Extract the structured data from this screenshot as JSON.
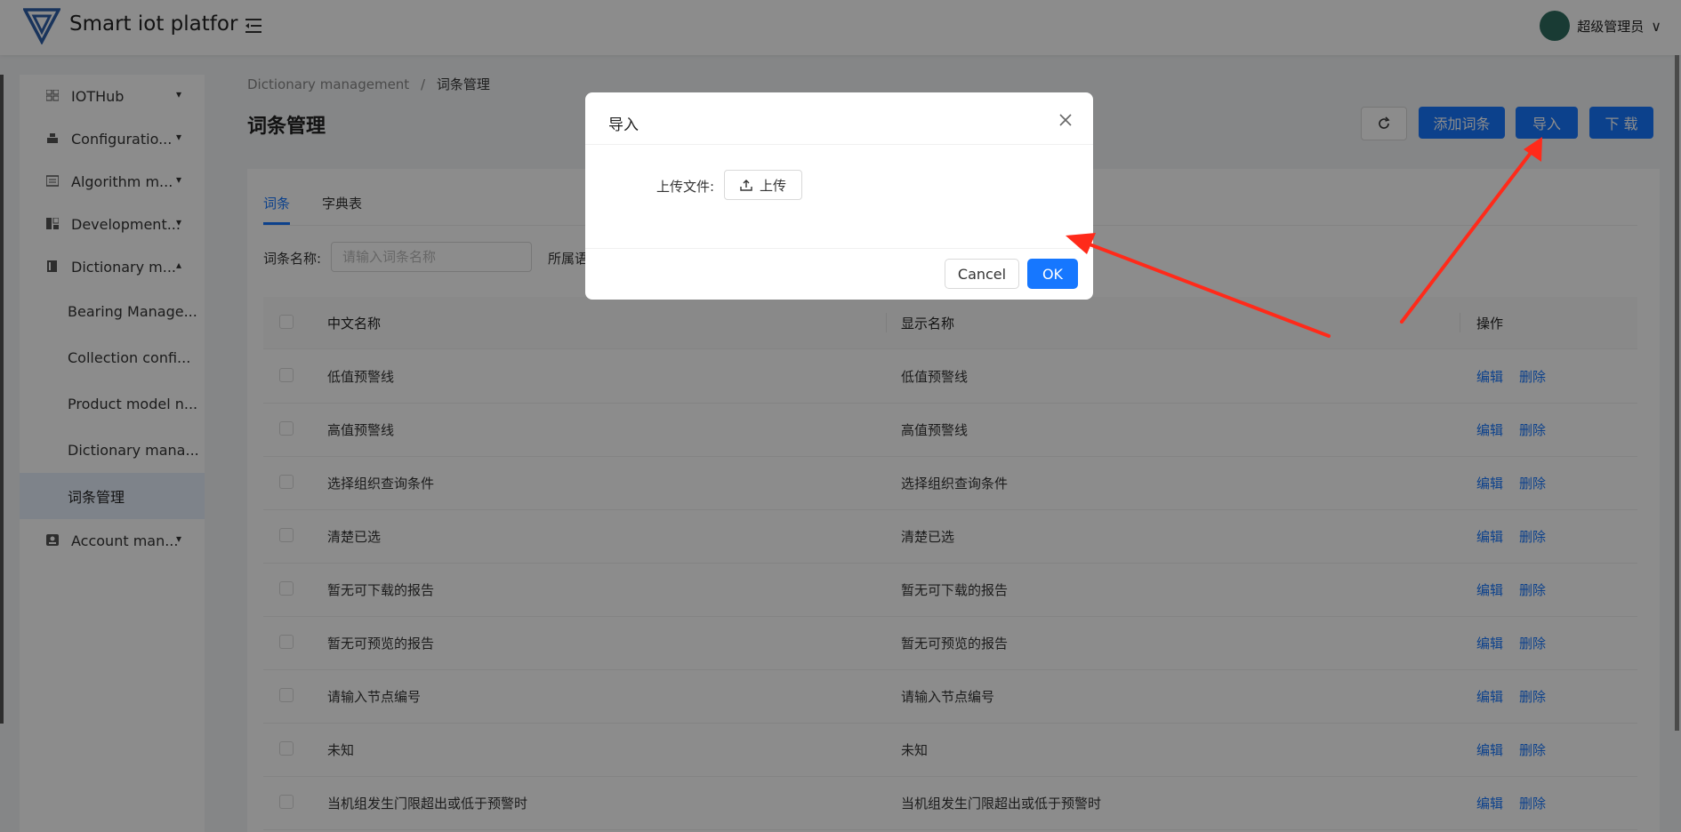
{
  "app": {
    "title": "Smart iot platfor",
    "user": "超级管理员"
  },
  "sidebar": {
    "items": [
      {
        "label": "IOTHub",
        "icon": "grid-icon",
        "expanded": false
      },
      {
        "label": "Configuratio...",
        "icon": "config-icon",
        "expanded": false
      },
      {
        "label": "Algorithm m...",
        "icon": "algorithm-icon",
        "expanded": false
      },
      {
        "label": "Development...",
        "icon": "development-icon",
        "expanded": false
      },
      {
        "label": "Dictionary m...",
        "icon": "book-icon",
        "expanded": true
      },
      {
        "label": "Account man...",
        "icon": "account-icon",
        "expanded": false
      }
    ],
    "subitems": [
      "Bearing Manage...",
      "Collection confi...",
      "Product model n...",
      "Dictionary mana...",
      "词条管理"
    ]
  },
  "breadcrumb": {
    "parent": "Dictionary management",
    "separator": "/",
    "current": "词条管理"
  },
  "page": {
    "title": "词条管理"
  },
  "actions": {
    "add": "添加词条",
    "import": "导入",
    "download": "下 载"
  },
  "tabs": [
    "词条",
    "字典表"
  ],
  "filters": {
    "name_label": "词条名称:",
    "name_placeholder": "请输入词条名称",
    "language_label": "所属语"
  },
  "table": {
    "columns": [
      "中文名称",
      "显示名称",
      "操作"
    ],
    "rows": [
      [
        "低值预警线",
        "低值预警线"
      ],
      [
        "高值预警线",
        "高值预警线"
      ],
      [
        "选择组织查询条件",
        "选择组织查询条件"
      ],
      [
        "清楚已选",
        "清楚已选"
      ],
      [
        "暂无可下载的报告",
        "暂无可下载的报告"
      ],
      [
        "暂无可预览的报告",
        "暂无可预览的报告"
      ],
      [
        "请输入节点编号",
        "请输入节点编号"
      ],
      [
        "未知",
        "未知"
      ],
      [
        "当机组发生门限超出或低于预警时",
        "当机组发生门限超出或低于预警时"
      ]
    ],
    "edit_label": "编辑",
    "delete_label": "删除"
  },
  "modal": {
    "title": "导入",
    "upload_label": "上传文件:",
    "upload_button": "上传",
    "cancel": "Cancel",
    "ok": "OK"
  },
  "colors": {
    "primary": "#1677ff",
    "annotation": "#ff2a1a"
  }
}
